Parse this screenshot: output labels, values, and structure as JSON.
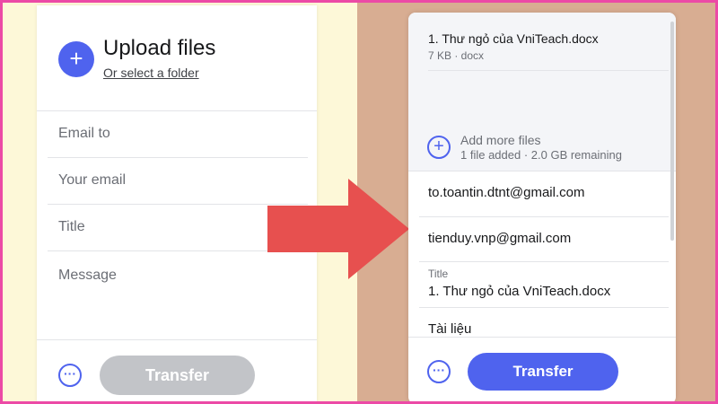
{
  "left_panel": {
    "upload_icon": "plus-icon",
    "upload_title": "Upload files",
    "select_folder": "Or select a folder",
    "email_to_placeholder": "Email to",
    "your_email_placeholder": "Your email",
    "title_placeholder": "Title",
    "message_placeholder": "Message",
    "more_icon": "more-options-icon",
    "transfer_label": "Transfer"
  },
  "right_panel": {
    "file": {
      "name": "1. Thư ngỏ của VniTeach.docx",
      "meta": "7 KB · docx"
    },
    "add_more": {
      "label": "Add more files",
      "meta": "1 file added · 2.0 GB remaining"
    },
    "email_to_value": "to.toantin.dtnt@gmail.com",
    "your_email_value": "tienduy.vnp@gmail.com",
    "title_label": "Title",
    "title_value": "1. Thư ngỏ của VniTeach.docx",
    "message_value": "Tài liệu",
    "more_icon": "more-options-icon",
    "transfer_label": "Transfer"
  },
  "colors": {
    "accent": "#4f63ee",
    "arrow": "#e7504f",
    "frame_border": "#ec4aa6",
    "disabled_button": "#c2c4c8"
  }
}
